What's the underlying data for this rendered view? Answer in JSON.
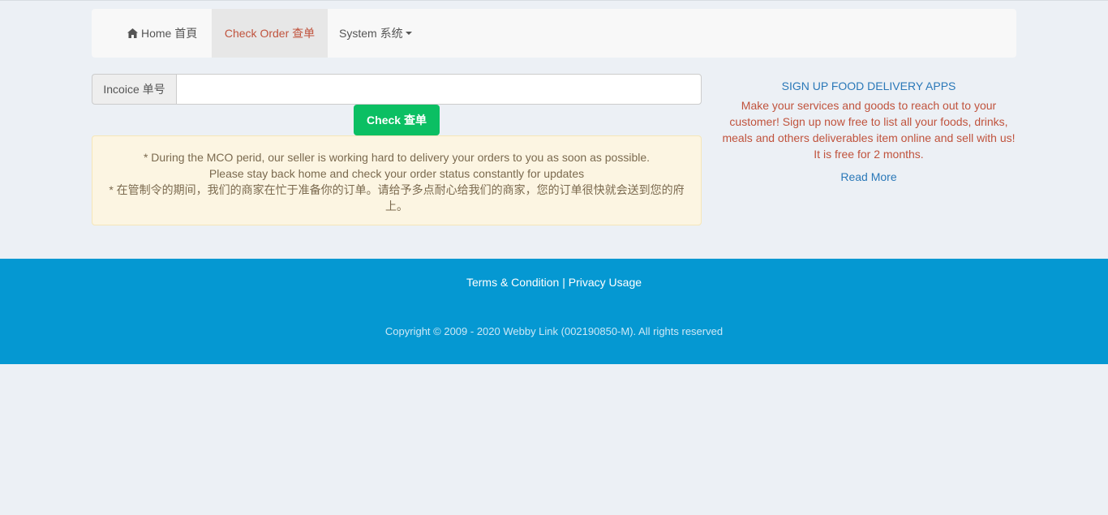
{
  "nav": {
    "home_label": "Home 首頁",
    "check_order_label": "Check Order 查单",
    "system_label": "System 系统"
  },
  "form": {
    "invoice_label": "Incoice 单号",
    "invoice_value": "",
    "check_button": "Check 查单"
  },
  "alert": {
    "line1": "* During the MCO perid, our seller is working hard to delivery your orders to you as soon as possible.",
    "line2": "Please stay back home and check your order status constantly for updates",
    "line3": "* 在管制令的期间，我们的商家在忙于准备你的订单。请给予多点耐心给我们的商家，您的订单很快就会送到您的府上。"
  },
  "promo": {
    "title": "SIGN UP FOOD DELIVERY APPS",
    "text": "Make your services and goods to reach out to your customer! Sign up now free to list all your foods, drinks, meals and others deliverables item online and sell with us! It is free for 2 months.",
    "read_more": "Read More"
  },
  "footer": {
    "terms": "Terms & Condition",
    "separator": "|",
    "privacy": "Privacy Usage",
    "copyright": "Copyright © 2009 - 2020 Webby Link (002190850-M). All rights reserved"
  },
  "colors": {
    "accent_active": "#c0533d",
    "button_green": "#0bbf63",
    "footer_blue": "#0598d2",
    "link_blue": "#2a78b8"
  }
}
